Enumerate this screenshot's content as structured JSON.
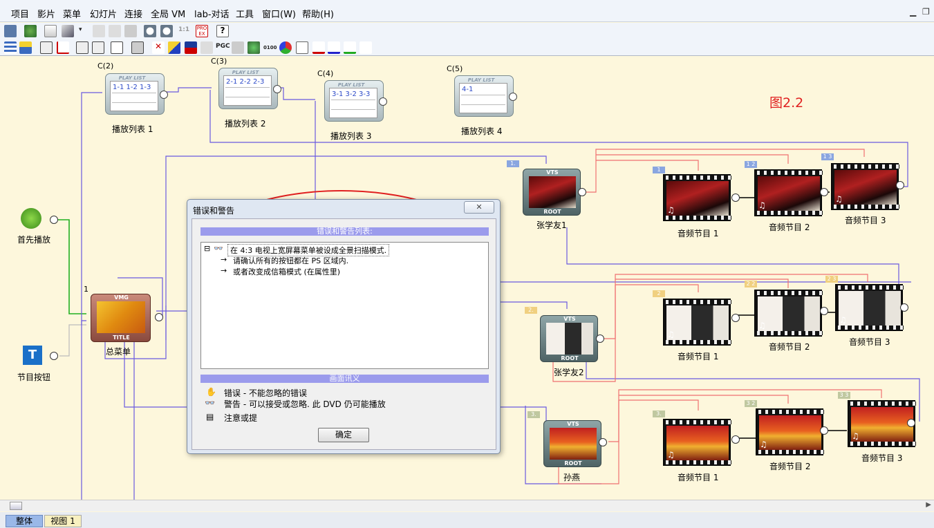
{
  "menu": [
    "项目",
    "影片",
    "菜单",
    "幻灯片",
    "连接",
    "全局 VM",
    "lab-对话",
    "工具",
    "窗口(W)",
    "帮助(H)"
  ],
  "toolbar": {
    "zoom_ratio": "1:1",
    "pgc_label": "PGC",
    "pro_ex": "PRO EX",
    "time_label": "0100"
  },
  "figure_label": "图2.2",
  "playlists": [
    {
      "code": "C(2)",
      "header": "PLAY LIST",
      "items": "1-1 1-2 1-3",
      "name": "播放列表 1"
    },
    {
      "code": "C(3)",
      "header": "PLAY LIST",
      "items": "2-1 2-2 2-3",
      "name": "播放列表 2"
    },
    {
      "code": "C(4)",
      "header": "PLAY LIST",
      "items": "3-1 3-2 3-3",
      "name": "播放列表 3"
    },
    {
      "code": "C(5)",
      "header": "PLAY LIST",
      "items": "4-1",
      "name": "播放列表 4"
    }
  ],
  "first_play": "首先播放",
  "title_button": "节目按钮",
  "vmg": {
    "top": "VMG",
    "bottom": "TITLE",
    "name": "总菜单",
    "index": "1"
  },
  "vts": [
    {
      "badge": "1.",
      "top": "VTS",
      "bottom": "ROOT",
      "name": "张学友1"
    },
    {
      "badge": "2.",
      "top": "VTS",
      "bottom": "ROOT",
      "name": "张学友2"
    },
    {
      "badge": "3.",
      "top": "VTS",
      "bottom": "ROOT",
      "name": "孙燕"
    }
  ],
  "tracks": [
    [
      {
        "badge": "1",
        "name": "音频节目 1"
      },
      {
        "badge": "1 2",
        "name": "音频节目 2"
      },
      {
        "badge": "1 3",
        "name": "音频节目 3"
      }
    ],
    [
      {
        "badge": "2",
        "name": "音频节目 1"
      },
      {
        "badge": "2 2",
        "name": "音频节目 2"
      },
      {
        "badge": "2 3",
        "name": "音频节目 3"
      }
    ],
    [
      {
        "badge": "3.",
        "name": "音频节目 1"
      },
      {
        "badge": "3 2",
        "name": "音频节目 2"
      },
      {
        "badge": "3 3",
        "name": "音频节目 3"
      }
    ]
  ],
  "dialog": {
    "title": "错误和警告",
    "close": "✕",
    "list_header": "错误和警告列表:",
    "items": [
      "在 4:3 电视上宽屏幕菜单被设成全景扫描模式.",
      "请确认所有的按钮都在 PS 区域内.",
      "或者改变成信箱模式 (在属性里)"
    ],
    "legend_header": "画面讯义",
    "legend": [
      "错误 - 不能忽略的错误",
      "警告 - 可以接受或忽略. 此 DVD 仍可能播放",
      "注意或提"
    ],
    "ok": "确定"
  },
  "tabs": [
    "整体",
    "视图 1"
  ],
  "colors": {
    "accent_blue": "#6a5ae0",
    "wire_red": "#f07070",
    "wire_green": "#20b020",
    "annotation_red": "#e02020"
  }
}
